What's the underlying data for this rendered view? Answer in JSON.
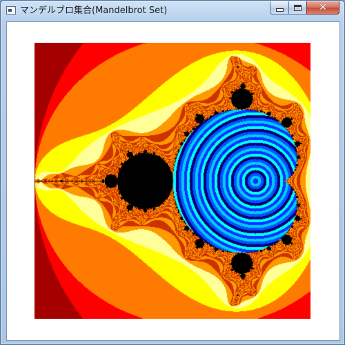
{
  "window": {
    "title": "マンデルブロ集合(Mandelbrot Set)",
    "icon": "app-window-icon"
  },
  "caption_buttons": {
    "minimize_icon": "minimize-icon",
    "maximize_icon": "maximize-icon",
    "close_icon": "close-icon",
    "close_glyph": "✕"
  },
  "fractal": {
    "set_name": "Mandelbrot Set",
    "region": {
      "re_min": -2.0,
      "re_max": 0.5,
      "im_min": -1.25,
      "im_max": 1.25
    },
    "escape_palette": [
      "#a40000",
      "#ff0000",
      "#ff7a00",
      "#ffff00",
      "#ffff99",
      "#ff9900",
      "#cc3300"
    ],
    "interior_color": "#000000",
    "inner_palette": [
      "#0033ff",
      "#00ccff",
      "#0055ff",
      "#000077",
      "#00ffff"
    ],
    "colors": {
      "frame_background": "#ffffff",
      "titlebar": "#b9d1ea",
      "close_button": "#c9503b"
    }
  }
}
